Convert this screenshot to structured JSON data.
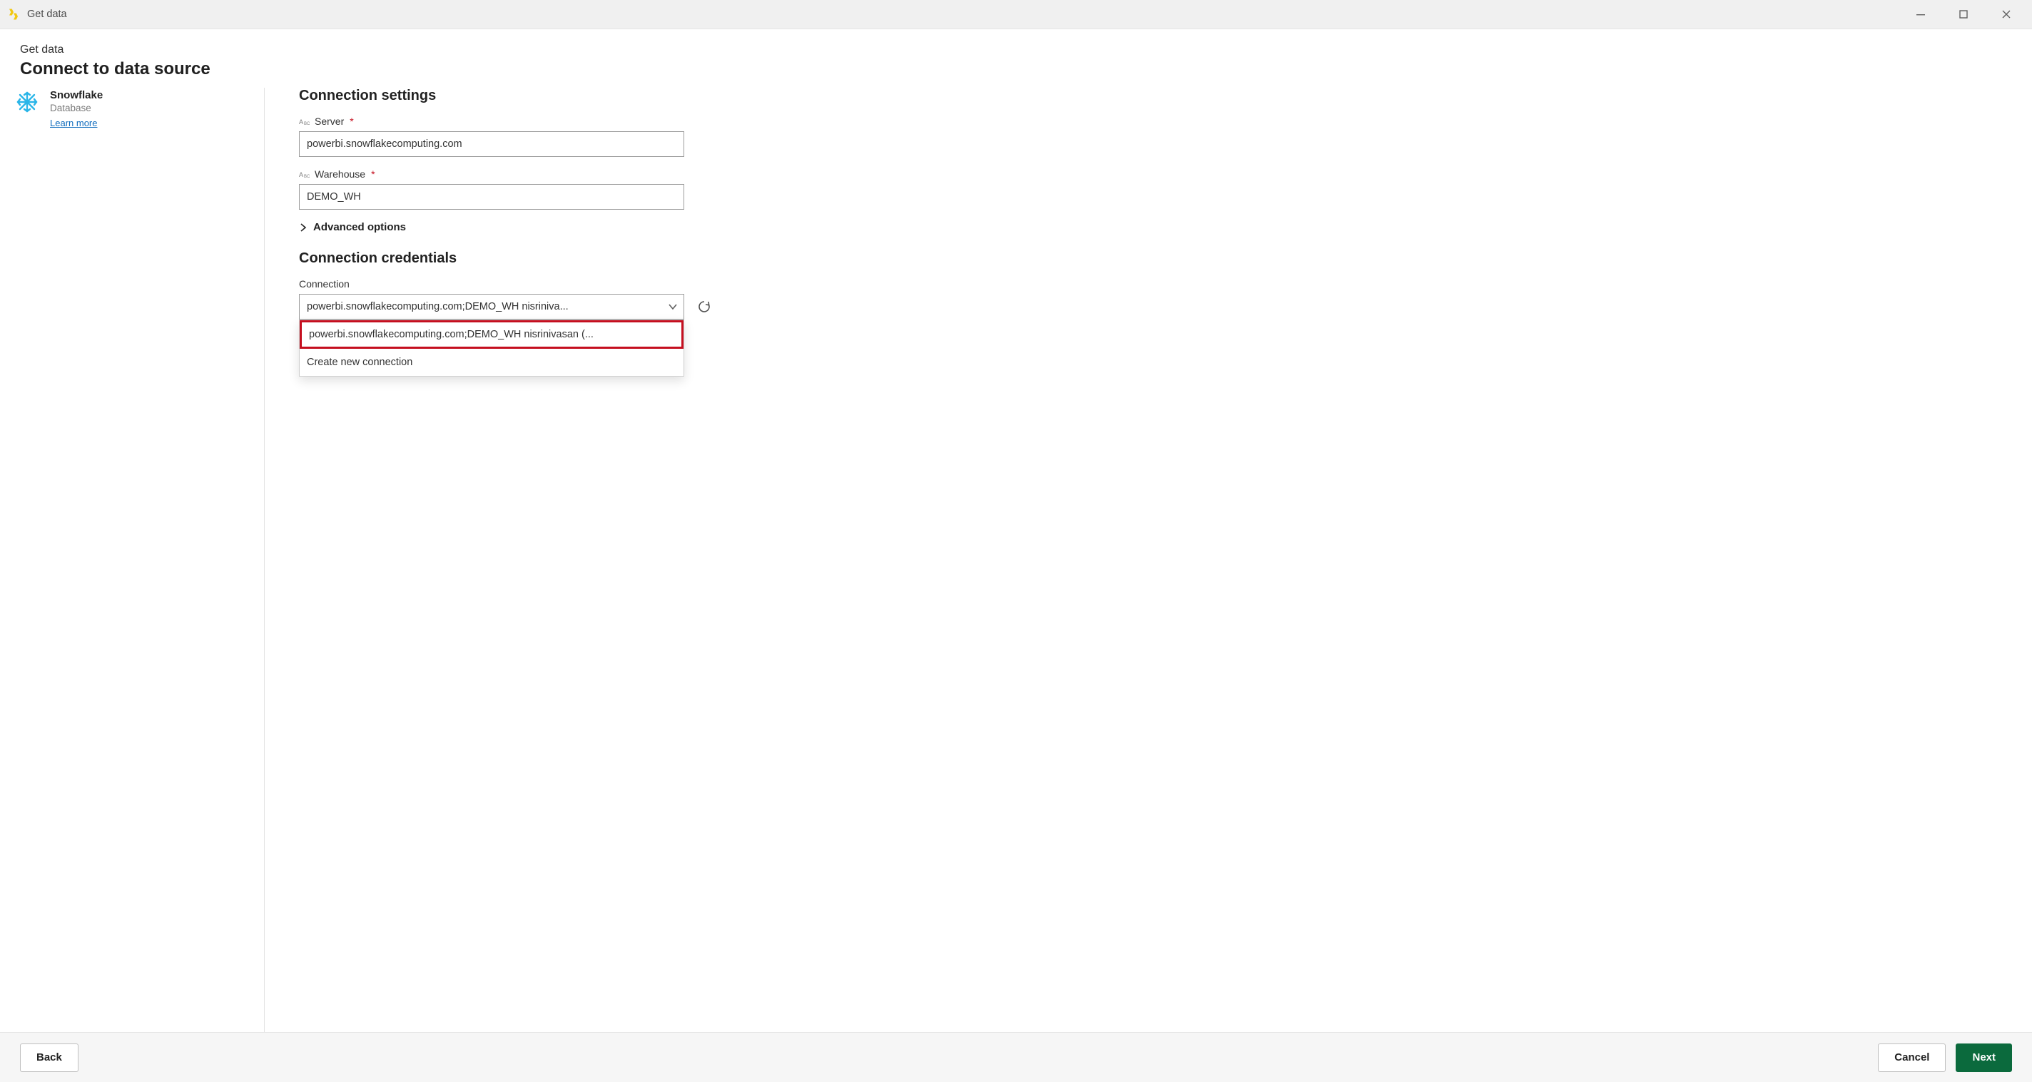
{
  "titlebar": {
    "title": "Get data"
  },
  "header": {
    "eyebrow": "Get data",
    "headline": "Connect to data source"
  },
  "sidebar": {
    "connector": {
      "name": "Snowflake",
      "subtitle": "Database",
      "learn_more": "Learn more"
    }
  },
  "settings": {
    "section_title": "Connection settings",
    "server_label": "Server",
    "server_value": "powerbi.snowflakecomputing.com",
    "warehouse_label": "Warehouse",
    "warehouse_value": "DEMO_WH",
    "advanced_label": "Advanced options"
  },
  "credentials": {
    "section_title": "Connection credentials",
    "connection_label": "Connection",
    "selected": "powerbi.snowflakecomputing.com;DEMO_WH nisriniva...",
    "options": [
      "powerbi.snowflakecomputing.com;DEMO_WH nisrinivasan (...",
      "Create new connection"
    ]
  },
  "footer": {
    "back": "Back",
    "cancel": "Cancel",
    "next": "Next"
  }
}
